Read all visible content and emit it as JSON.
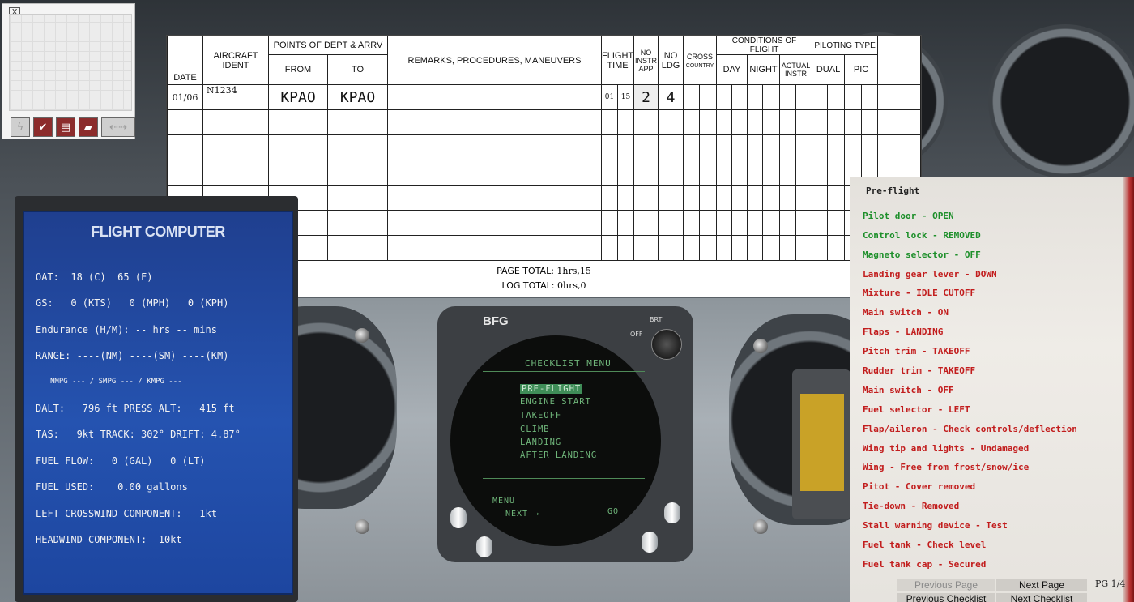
{
  "mini_panel": {
    "close_label": "X",
    "icons": [
      "lightning-icon",
      "checkmark-icon",
      "instrument-panel-icon",
      "logbook-icon",
      "navigation-arrows-icon"
    ]
  },
  "logbook": {
    "headers": {
      "date": "DATE",
      "aircraft_ident": "AIRCRAFT IDENT",
      "points": "POINTS OF DEPT & ARRV",
      "from": "FROM",
      "to": "TO",
      "remarks": "REMARKS, PROCEDURES, MANEUVERS",
      "flight_time": "FLIGHT TIME",
      "no_instr_app": "NO INSTR APP",
      "no_ldg": "NO LDG",
      "cross_country": "CROSS",
      "cross_country2": "COUNTRY",
      "conditions": "CONDITIONS OF FLIGHT",
      "day": "DAY",
      "night": "NIGHT",
      "actual_instr": "ACTUAL INSTR",
      "piloting_type": "PILOTING TYPE",
      "dual": "DUAL",
      "pic": "PIC"
    },
    "entry": {
      "date": "01/06",
      "aircraft": "N1234",
      "from": "KPAO",
      "to": "KPAO",
      "hours": "01",
      "minutes": "15",
      "instr_app": "2",
      "landings": "4"
    },
    "page_total_label": "PAGE TOTAL:",
    "page_total": "1hrs,15",
    "log_total_label": "LOG TOTAL:",
    "log_total": "0hrs,0"
  },
  "flight_computer": {
    "title": "FLIGHT COMPUTER",
    "oat": "OAT:  18 (C)  65 (F)",
    "gs": "GS:   0 (KTS)   0 (MPH)   0 (KPH)",
    "endurance": "Endurance (H/M): -- hrs -- mins",
    "range": "RANGE: ----(NM) ----(SM) ----(KM)",
    "mpg": "NMPG --- / SMPG --- / KMPG ---",
    "dalt": "DALT:   796 ft PRESS ALT:   415 ft",
    "tas": "TAS:   9kt TRACK: 302° DRIFT: 4.87°",
    "fuel_flow": "FUEL FLOW:   0 (GAL)   0 (LT)",
    "fuel_used": "FUEL USED:    0.00 gallons",
    "crosswind": "LEFT CROSSWIND COMPONENT:   1kt",
    "headwind": "HEADWIND COMPONENT:  10kt"
  },
  "bfg": {
    "brand": "BFG",
    "brt": "BRT",
    "off": "OFF",
    "menu_title": "CHECKLIST MENU",
    "items": [
      "PRE-FLIGHT",
      "ENGINE START",
      "TAKEOFF",
      "CLIMB",
      "LANDING",
      "AFTER LANDING"
    ],
    "menu": "MENU",
    "next": "NEXT →",
    "go": "GO"
  },
  "checklist": {
    "title": "Pre-flight",
    "items": [
      {
        "text": "Pilot door - OPEN",
        "color": "green"
      },
      {
        "text": "Control lock - REMOVED",
        "color": "green"
      },
      {
        "text": "Magneto selector - OFF",
        "color": "green"
      },
      {
        "text": "Landing gear lever - DOWN",
        "color": "red"
      },
      {
        "text": "Mixture - IDLE CUTOFF",
        "color": "red"
      },
      {
        "text": "Main switch - ON",
        "color": "red"
      },
      {
        "text": "Flaps - LANDING",
        "color": "red"
      },
      {
        "text": "Pitch trim - TAKEOFF",
        "color": "red"
      },
      {
        "text": "Rudder trim - TAKEOFF",
        "color": "red"
      },
      {
        "text": "Main switch - OFF",
        "color": "red"
      },
      {
        "text": "Fuel selector - LEFT",
        "color": "red"
      },
      {
        "text": "Flap/aileron - Check controls/deflection",
        "color": "red"
      },
      {
        "text": "Wing tip and lights - Undamaged",
        "color": "red"
      },
      {
        "text": "Wing - Free from frost/snow/ice",
        "color": "red"
      },
      {
        "text": "Pitot - Cover removed",
        "color": "red"
      },
      {
        "text": "Tie-down - Removed",
        "color": "red"
      },
      {
        "text": "Stall warning device - Test",
        "color": "red"
      },
      {
        "text": "Fuel tank - Check level",
        "color": "red"
      },
      {
        "text": "Fuel tank cap - Secured",
        "color": "red"
      }
    ],
    "prev_page": "Previous Page",
    "next_page": "Next Page",
    "page_indicator": "PG 1/4",
    "prev_checklist": "Previous Checklist",
    "next_checklist": "Next Checklist"
  },
  "colors": {
    "checked": "#1d8f2a",
    "unchecked": "#c21d1d",
    "fc_screen": "#2553b0",
    "bfg_text": "#6fb57a"
  }
}
